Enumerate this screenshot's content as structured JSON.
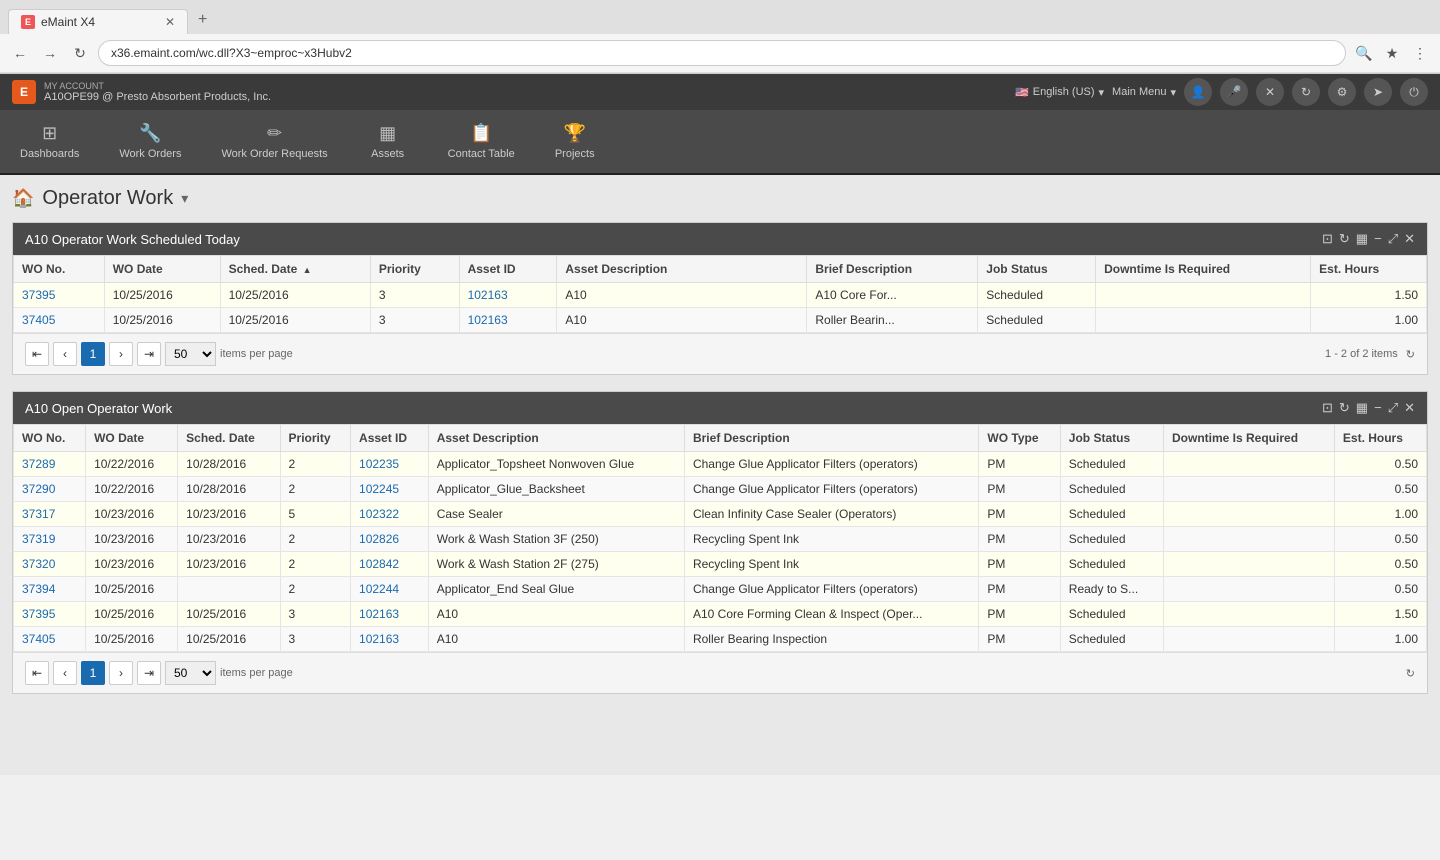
{
  "browser": {
    "tab_title": "eMaint X4",
    "tab_favicon": "E",
    "url": "x36.emaint.com/wc.dll?X3~emproc~x3Hubv2",
    "new_tab_label": "+"
  },
  "app_header": {
    "logo_text": "E",
    "my_account_label": "MY ACCOUNT",
    "account_name": "A10OPE99 @ Presto Absorbent Products, Inc.",
    "lang": "English (US)",
    "main_menu": "Main Menu"
  },
  "nav": {
    "items": [
      {
        "icon": "⊞",
        "label": "Dashboards"
      },
      {
        "icon": "🔧",
        "label": "Work Orders"
      },
      {
        "icon": "✏️",
        "label": "Work Order Requests"
      },
      {
        "icon": "▦",
        "label": "Assets"
      },
      {
        "icon": "📋",
        "label": "Contact Table"
      },
      {
        "icon": "🏆",
        "label": "Projects"
      }
    ]
  },
  "page": {
    "title": "Operator Work",
    "home_icon": "🏠"
  },
  "scheduled_panel": {
    "title": "A10 Operator Work Scheduled Today",
    "columns": [
      "WO No.",
      "WO Date",
      "Sched. Date",
      "Priority",
      "Asset ID",
      "Asset Description",
      "Brief Description",
      "Job Status",
      "Downtime Is Required",
      "Est. Hours"
    ],
    "rows": [
      {
        "wo_no": "37395",
        "wo_date": "10/25/2016",
        "sched_date": "10/25/2016",
        "priority": "3",
        "asset_id": "102163",
        "asset_desc": "A10",
        "brief_desc": "A10 Core For...",
        "job_status": "Scheduled",
        "downtime": "",
        "est_hours": "1.50"
      },
      {
        "wo_no": "37405",
        "wo_date": "10/25/2016",
        "sched_date": "10/25/2016",
        "priority": "3",
        "asset_id": "102163",
        "asset_desc": "A10",
        "brief_desc": "Roller Bearin...",
        "job_status": "Scheduled",
        "downtime": "",
        "est_hours": "1.00"
      }
    ],
    "pagination": {
      "current_page": 1,
      "per_page": "50",
      "items_label": "items per page",
      "count_label": "1 - 2 of 2 items"
    }
  },
  "open_panel": {
    "title": "A10 Open Operator Work",
    "columns": [
      "WO No.",
      "WO Date",
      "Sched. Date",
      "Priority",
      "Asset ID",
      "Asset Description",
      "Brief Description",
      "WO Type",
      "Job Status",
      "Downtime Is Required",
      "Est. Hours"
    ],
    "rows": [
      {
        "wo_no": "37289",
        "wo_date": "10/22/2016",
        "sched_date": "10/28/2016",
        "priority": "2",
        "asset_id": "102235",
        "asset_desc": "Applicator_Topsheet Nonwoven Glue",
        "brief_desc": "Change Glue Applicator Filters (operators)",
        "wo_type": "PM",
        "job_status": "Scheduled",
        "downtime": "",
        "est_hours": "0.50"
      },
      {
        "wo_no": "37290",
        "wo_date": "10/22/2016",
        "sched_date": "10/28/2016",
        "priority": "2",
        "asset_id": "102245",
        "asset_desc": "Applicator_Glue_Backsheet",
        "brief_desc": "Change Glue Applicator Filters (operators)",
        "wo_type": "PM",
        "job_status": "Scheduled",
        "downtime": "",
        "est_hours": "0.50"
      },
      {
        "wo_no": "37317",
        "wo_date": "10/23/2016",
        "sched_date": "10/23/2016",
        "priority": "5",
        "asset_id": "102322",
        "asset_desc": "Case Sealer",
        "brief_desc": "Clean Infinity Case Sealer (Operators)",
        "wo_type": "PM",
        "job_status": "Scheduled",
        "downtime": "",
        "est_hours": "1.00"
      },
      {
        "wo_no": "37319",
        "wo_date": "10/23/2016",
        "sched_date": "10/23/2016",
        "priority": "2",
        "asset_id": "102826",
        "asset_desc": "Work & Wash Station 3F (250)",
        "brief_desc": "Recycling Spent Ink",
        "wo_type": "PM",
        "job_status": "Scheduled",
        "downtime": "",
        "est_hours": "0.50"
      },
      {
        "wo_no": "37320",
        "wo_date": "10/23/2016",
        "sched_date": "10/23/2016",
        "priority": "2",
        "asset_id": "102842",
        "asset_desc": "Work & Wash Station 2F (275)",
        "brief_desc": "Recycling Spent Ink",
        "wo_type": "PM",
        "job_status": "Scheduled",
        "downtime": "",
        "est_hours": "0.50"
      },
      {
        "wo_no": "37394",
        "wo_date": "10/25/2016",
        "sched_date": "",
        "priority": "2",
        "asset_id": "102244",
        "asset_desc": "Applicator_End Seal Glue",
        "brief_desc": "Change Glue Applicator Filters (operators)",
        "wo_type": "PM",
        "job_status": "Ready to S...",
        "downtime": "",
        "est_hours": "0.50"
      },
      {
        "wo_no": "37395",
        "wo_date": "10/25/2016",
        "sched_date": "10/25/2016",
        "priority": "3",
        "asset_id": "102163",
        "asset_desc": "A10",
        "brief_desc": "A10 Core Forming Clean & Inspect (Oper...",
        "wo_type": "PM",
        "job_status": "Scheduled",
        "downtime": "",
        "est_hours": "1.50"
      },
      {
        "wo_no": "37405",
        "wo_date": "10/25/2016",
        "sched_date": "10/25/2016",
        "priority": "3",
        "asset_id": "102163",
        "asset_desc": "A10",
        "brief_desc": "Roller Bearing Inspection",
        "wo_type": "PM",
        "job_status": "Scheduled",
        "downtime": "",
        "est_hours": "1.00"
      }
    ],
    "pagination": {
      "current_page": 1,
      "per_page": "50",
      "items_label": "items per page"
    }
  }
}
